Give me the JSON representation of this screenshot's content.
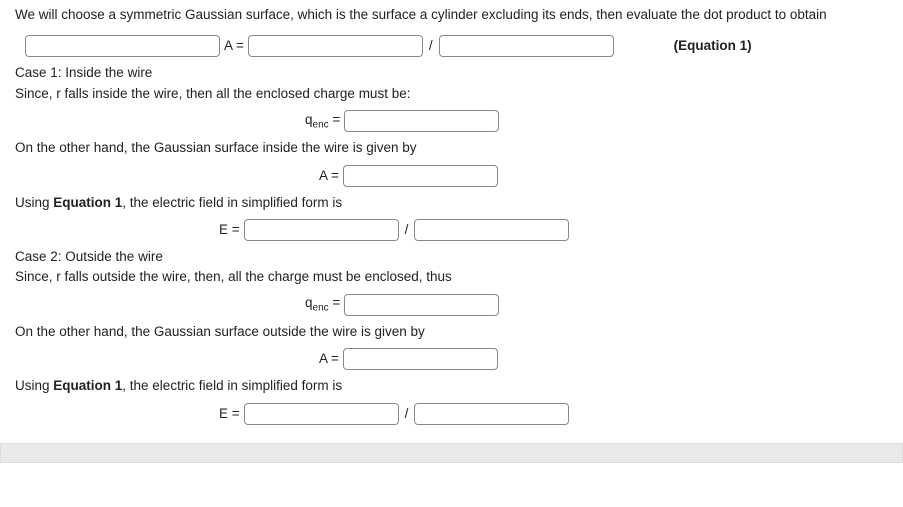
{
  "intro": "We will choose a symmetric Gaussian surface, which is the surface a cylinder excluding its ends, then evaluate the dot product to obtain",
  "eq1": {
    "lhs_lbl": "A =",
    "slash": "/",
    "note": "(Equation 1)"
  },
  "case1": {
    "title": "Case 1: Inside the wire",
    "since": "Since, r falls inside the wire, then all the enclosed charge must be:",
    "qenc_lbl_pre": "q",
    "qenc_sub": "enc",
    "qenc_lbl_post": " =",
    "area_text": "On the other hand, the Gaussian surface inside the wire is given by",
    "area_lbl": "A =",
    "use_pre": "Using ",
    "use_bold": "Equation 1",
    "use_post": ", the electric field in simplified form is",
    "e_lbl": "E =",
    "slash": "/"
  },
  "case2": {
    "title": "Case 2: Outside the wire",
    "since": "Since, r falls outside the wire, then, all the charge must be enclosed, thus",
    "qenc_lbl_pre": "q",
    "qenc_sub": "enc",
    "qenc_lbl_post": " =",
    "area_text": "On the other hand, the Gaussian surface outside the wire is given by",
    "area_lbl": "A =",
    "use_pre": "Using ",
    "use_bold": "Equation 1",
    "use_post": ", the electric field in simplified form is",
    "e_lbl": "E =",
    "slash": "/"
  }
}
